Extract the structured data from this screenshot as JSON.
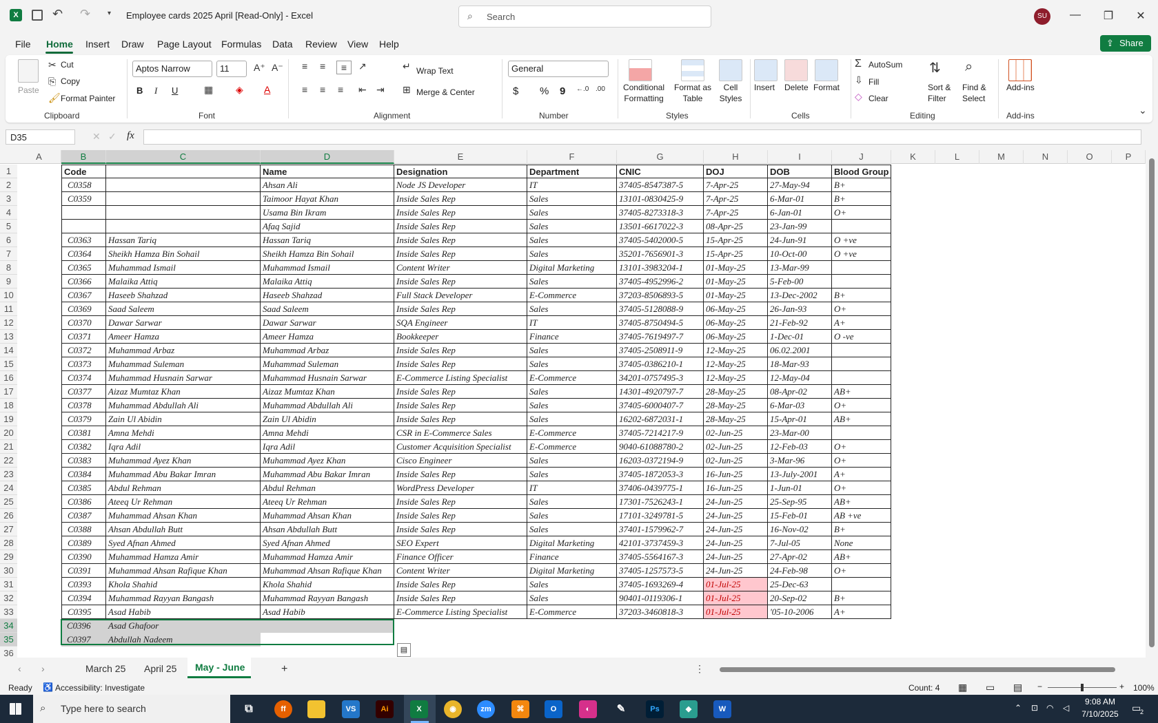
{
  "titlebar": {
    "doc_title": "Employee cards 2025 April  [Read-Only]  -  Excel",
    "search_placeholder": "Search",
    "user_initials": "SU",
    "minimize": "—",
    "maximize": "❐",
    "close": "✕"
  },
  "menu": {
    "items": [
      "File",
      "Home",
      "Insert",
      "Draw",
      "Page Layout",
      "Formulas",
      "Data",
      "Review",
      "View",
      "Help"
    ],
    "share": "Share"
  },
  "ribbon": {
    "clipboard": {
      "paste": "Paste",
      "cut": "Cut",
      "copy": "Copy",
      "format_painter": "Format Painter",
      "group": "Clipboard"
    },
    "font": {
      "name": "Aptos Narrow",
      "size": "11",
      "bold": "B",
      "italic": "I",
      "underline": "U",
      "group": "Font"
    },
    "alignment": {
      "wrap": "Wrap Text",
      "merge": "Merge & Center",
      "group": "Alignment"
    },
    "number": {
      "format": "General",
      "currency": "$",
      "percent": "%",
      "comma": "9",
      "group": "Number"
    },
    "styles": {
      "conditional": "Conditional",
      "conditional2": "Formatting",
      "format_table": "Format as",
      "format_table2": "Table",
      "cell_styles": "Cell",
      "cell_styles2": "Styles",
      "group": "Styles"
    },
    "cells": {
      "insert": "Insert",
      "delete": "Delete",
      "format": "Format",
      "group": "Cells"
    },
    "editing": {
      "autosum": "AutoSum",
      "fill": "Fill",
      "clear": "Clear",
      "sort": "Sort &",
      "sort2": "Filter",
      "find": "Find &",
      "find2": "Select",
      "group": "Editing"
    },
    "addins": {
      "label": "Add-ins",
      "group": "Add-ins"
    }
  },
  "formula_bar": {
    "name_box": "D35",
    "fx": "fx",
    "formula": ""
  },
  "columns": [
    "A",
    "B",
    "C",
    "D",
    "E",
    "F",
    "G",
    "H",
    "I",
    "J",
    "K",
    "L",
    "M",
    "N",
    "O",
    "P"
  ],
  "header_row": [
    "Code",
    "",
    "Name",
    "Designation",
    "Department",
    "CNIC",
    "DOJ",
    "DOB",
    "Blood Group"
  ],
  "rows": [
    [
      "C0358",
      "",
      "Ahsan Ali",
      "Node JS Developer",
      "IT",
      "37405-8547387-5",
      "7-Apr-25",
      "27-May-94",
      "B+"
    ],
    [
      "C0359",
      "",
      "Taimoor Hayat Khan",
      "Inside Sales Rep",
      "Sales",
      "13101-0830425-9",
      "7-Apr-25",
      "6-Mar-01",
      "B+"
    ],
    [
      "",
      "",
      "Usama Bin Ikram",
      "Inside Sales Rep",
      "Sales",
      "37405-8273318-3",
      "7-Apr-25",
      "6-Jan-01",
      "O+"
    ],
    [
      "",
      "",
      "Afaq Sajid",
      "Inside Sales Rep",
      "Sales",
      "13501-6617022-3",
      "08-Apr-25",
      "23-Jan-99",
      ""
    ],
    [
      "C0363",
      "Hassan Tariq",
      "Hassan Tariq",
      "Inside Sales Rep",
      "Sales",
      "37405-5402000-5",
      "15-Apr-25",
      "24-Jun-91",
      "O +ve"
    ],
    [
      "C0364",
      "Sheikh Hamza Bin Sohail",
      "Sheikh Hamza Bin Sohail",
      "Inside Sales Rep",
      "Sales",
      "35201-7656901-3",
      "15-Apr-25",
      "10-Oct-00",
      "O +ve"
    ],
    [
      "C0365",
      "Muhammad Ismail",
      "Muhammad Ismail",
      "Content Writer",
      "Digital Marketing",
      "13101-3983204-1",
      "01-May-25",
      "13-Mar-99",
      ""
    ],
    [
      "C0366",
      "Malaika Attiq",
      "Malaika Attiq",
      "Inside Sales Rep",
      "Sales",
      "37405-4952996-2",
      "01-May-25",
      "5-Feb-00",
      ""
    ],
    [
      "C0367",
      "Haseeb Shahzad",
      "Haseeb Shahzad",
      "Full Stack Developer",
      "E-Commerce",
      "37203-8506893-5",
      "01-May-25",
      "13-Dec-2002",
      "B+"
    ],
    [
      "C0369",
      "Saad Saleem",
      "Saad Saleem",
      "Inside Sales Rep",
      "Sales",
      "37405-5128088-9",
      "06-May-25",
      "26-Jan-93",
      "O+"
    ],
    [
      "C0370",
      "Dawar Sarwar",
      "Dawar Sarwar",
      "SQA Engineer",
      "IT",
      "37405-8750494-5",
      "06-May-25",
      "21-Feb-92",
      "A+"
    ],
    [
      "C0371",
      "Ameer Hamza",
      "Ameer Hamza",
      "Bookkeeper",
      "Finance",
      "37405-7619497-7",
      "06-May-25",
      "1-Dec-01",
      "O -ve"
    ],
    [
      "C0372",
      "Muhammad Arbaz",
      "Muhammad Arbaz",
      "Inside Sales Rep",
      "Sales",
      "37405-2508911-9",
      "12-May-25",
      "06.02.2001",
      ""
    ],
    [
      "C0373",
      "Muhammad Suleman",
      "Muhammad Suleman",
      "Inside Sales Rep",
      "Sales",
      "37405-0386210-1",
      "12-May-25",
      "18-Mar-93",
      ""
    ],
    [
      "C0374",
      "Muhammad Husnain Sarwar",
      "Muhammad Husnain Sarwar",
      "E-Commerce Listing Specialist",
      "E-Commerce",
      "34201-0757495-3",
      "12-May-25",
      "12-May-04",
      ""
    ],
    [
      "C0377",
      "Aizaz Mumtaz Khan",
      "Aizaz Mumtaz Khan",
      "Inside Sales Rep",
      "Sales",
      "14301-4920797-7",
      "28-May-25",
      "08-Apr-02",
      "AB+"
    ],
    [
      "C0378",
      "Muhammad Abdullah Ali",
      "Muhammad Abdullah Ali",
      "Inside Sales Rep",
      "Sales",
      "37405-6000407-7",
      "28-May-25",
      "6-Mar-03",
      "O+"
    ],
    [
      "C0379",
      "Zain Ul Abidin",
      "Zain Ul Abidin",
      "Inside Sales Rep",
      "Sales",
      "16202-6872031-1",
      "28-May-25",
      "15-Apr-01",
      "AB+"
    ],
    [
      "C0381",
      "Amna Mehdi",
      "Amna Mehdi",
      "CSR in E-Commerce Sales",
      "E-Commerce",
      "37405-7214217-9",
      "02-Jun-25",
      "23-Mar-00",
      ""
    ],
    [
      "C0382",
      "Iqra Adil",
      "Iqra Adil",
      "Customer Acquisition Specialist",
      "E-Commerce",
      "9040-61088780-2",
      "02-Jun-25",
      "12-Feb-03",
      "O+"
    ],
    [
      "C0383",
      "Muhammad Ayez Khan",
      "Muhammad Ayez Khan",
      "Cisco Engineer",
      "Sales",
      "16203-0372194-9",
      "02-Jun-25",
      "3-Mar-96",
      "O+"
    ],
    [
      "C0384",
      "Muhammad Abu Bakar Imran",
      "Muhammad Abu Bakar Imran",
      "Inside Sales Rep",
      "Sales",
      "37405-1872053-3",
      "16-Jun-25",
      "13-July-2001",
      "A+"
    ],
    [
      "C0385",
      "Abdul Rehman",
      "Abdul Rehman",
      "WordPress Developer",
      "IT",
      "37406-0439775-1",
      "16-Jun-25",
      "1-Jun-01",
      "O+"
    ],
    [
      "C0386",
      "Ateeq Ur Rehman",
      "Ateeq Ur Rehman",
      "Inside Sales Rep",
      "Sales",
      "17301-7526243-1",
      "24-Jun-25",
      "25-Sep-95",
      "AB+"
    ],
    [
      "C0387",
      "Muhammad Ahsan Khan",
      "Muhammad Ahsan Khan",
      "Inside Sales Rep",
      "Sales",
      "17101-3249781-5",
      "24-Jun-25",
      "15-Feb-01",
      "AB +ve"
    ],
    [
      "C0388",
      "Ahsan Abdullah Butt",
      "Ahsan Abdullah Butt",
      "Inside Sales Rep",
      "Sales",
      "37401-1579962-7",
      "24-Jun-25",
      "16-Nov-02",
      "B+"
    ],
    [
      "C0389",
      "Syed Afnan Ahmed",
      "Syed Afnan Ahmed",
      "SEO Expert",
      "Digital Marketing",
      "42101-3737459-3",
      "24-Jun-25",
      "7-Jul-05",
      "None"
    ],
    [
      "C0390",
      "Muhammad Hamza Amir",
      "Muhammad Hamza Amir",
      "Finance Officer",
      "Finance",
      "37405-5564167-3",
      "24-Jun-25",
      "27-Apr-02",
      "AB+"
    ],
    [
      "C0391",
      "Muhammad Ahsan Rafique Khan",
      "Muhammad Ahsan Rafique Khan",
      "Content Writer",
      "Digital Marketing",
      "37405-1257573-5",
      "24-Jun-25",
      "24-Feb-98",
      "O+"
    ],
    [
      "C0393",
      "Khola Shahid",
      "Khola Shahid",
      "Inside Sales Rep",
      "Sales",
      "37405-1693269-4",
      "01-Jul-25",
      "25-Dec-63",
      ""
    ],
    [
      "C0394",
      "Muhammad Rayyan Bangash",
      "Muhammad Rayyan Bangash",
      "Inside Sales Rep",
      "Sales",
      "90401-0119306-1",
      "01-Jul-25",
      "20-Sep-02",
      "B+"
    ],
    [
      "C0395",
      "Asad Habib",
      "Asad Habib",
      "E-Commerce Listing Specialist",
      "E-Commerce",
      "37203-3460818-3",
      "01-Jul-25",
      "'05-10-2006",
      "A+"
    ],
    [
      "C0396",
      "Asad Ghafoor",
      "",
      "",
      "",
      "",
      "",
      "",
      ""
    ],
    [
      "C0397",
      "Abdullah Nadeem",
      "",
      "",
      "",
      "",
      "",
      "",
      ""
    ]
  ],
  "sheet_tabs": [
    "March 25",
    "April 25",
    "May - June"
  ],
  "add_sheet": "+",
  "status": {
    "ready": "Ready",
    "accessibility": "Accessibility: Investigate",
    "count": "Count: 4",
    "zoom": "100%"
  },
  "taskbar": {
    "search_placeholder": "Type here to search",
    "time": "9:08 AM",
    "date": "7/10/2025",
    "notifications": "2"
  }
}
